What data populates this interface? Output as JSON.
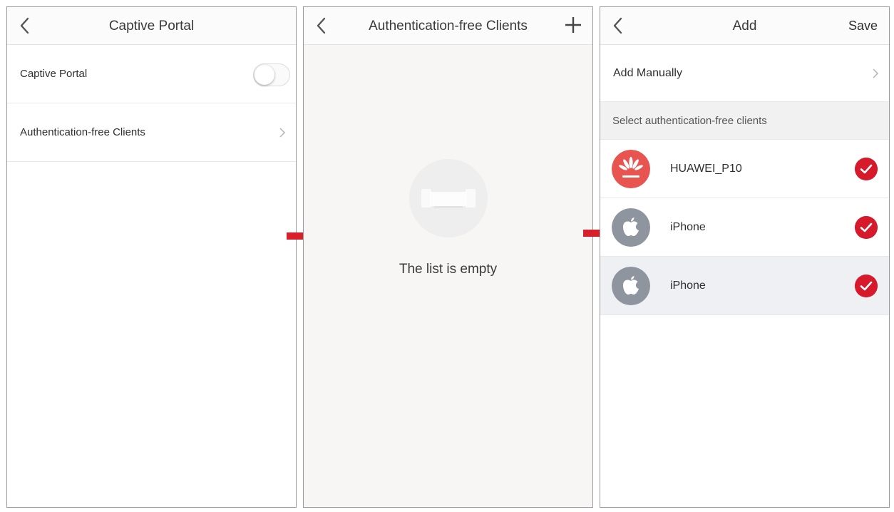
{
  "panel1": {
    "title": "Captive Portal",
    "rows": [
      {
        "label": "Captive Portal",
        "type": "toggle",
        "toggle_on": false
      },
      {
        "label": "Authentication-free Clients",
        "type": "link"
      }
    ]
  },
  "panel2": {
    "title": "Authentication-free Clients",
    "empty_text": "The list is empty"
  },
  "panel3": {
    "title": "Add",
    "save_label": "Save",
    "add_manually_label": "Add Manually",
    "section_header": "Select authentication-free clients",
    "clients": [
      {
        "name": "HUAWEI_P10",
        "icon": "huawei-logo-icon",
        "selected": true
      },
      {
        "name": "iPhone",
        "icon": "apple-logo-icon",
        "selected": true
      },
      {
        "name": "iPhone",
        "icon": "apple-logo-icon",
        "selected": true
      }
    ]
  },
  "colors": {
    "accent_red": "#d61a2c",
    "huawei_red": "#e8544f",
    "apple_gray": "#8f959e",
    "arrow_red": "#d8202a"
  }
}
